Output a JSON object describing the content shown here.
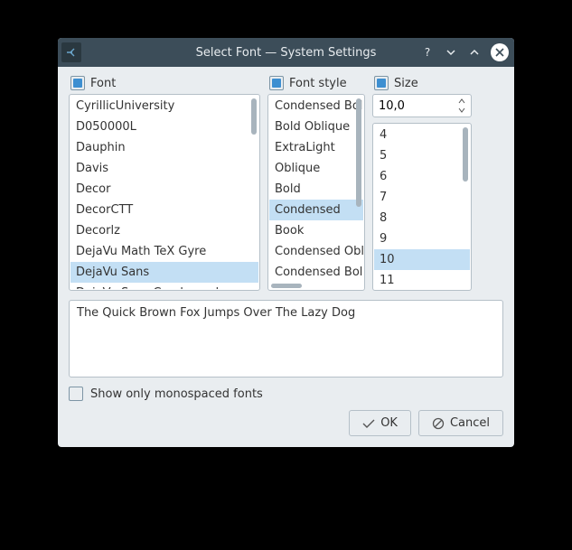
{
  "window": {
    "title": "Select Font — System Settings"
  },
  "labels": {
    "font": "Font",
    "style": "Font style",
    "size": "Size",
    "monospace": "Show only monospaced fonts",
    "ok": "OK",
    "cancel": "Cancel"
  },
  "fontList": {
    "items": [
      "CyrillicUniversity",
      "D050000L",
      "Dauphin",
      "Davis",
      "Decor",
      "DecorCTT",
      "Decorlz",
      "DejaVu Math TeX Gyre",
      "DejaVu Sans",
      "DejaVu Sans Condensed"
    ],
    "selected": "DejaVu Sans"
  },
  "styleList": {
    "items": [
      "Condensed Bold",
      "Bold Oblique",
      "ExtraLight",
      "Oblique",
      "Bold",
      "Condensed",
      "Book",
      "Condensed Oblique",
      "Condensed Bold Oblique"
    ],
    "selected": "Condensed"
  },
  "sizeSpin": {
    "value": "10,0"
  },
  "sizeList": {
    "items": [
      "4",
      "5",
      "6",
      "7",
      "8",
      "9",
      "10",
      "11"
    ],
    "selected": "10"
  },
  "preview": {
    "text": "The Quick Brown Fox Jumps Over The Lazy Dog"
  },
  "monospaceChecked": false
}
